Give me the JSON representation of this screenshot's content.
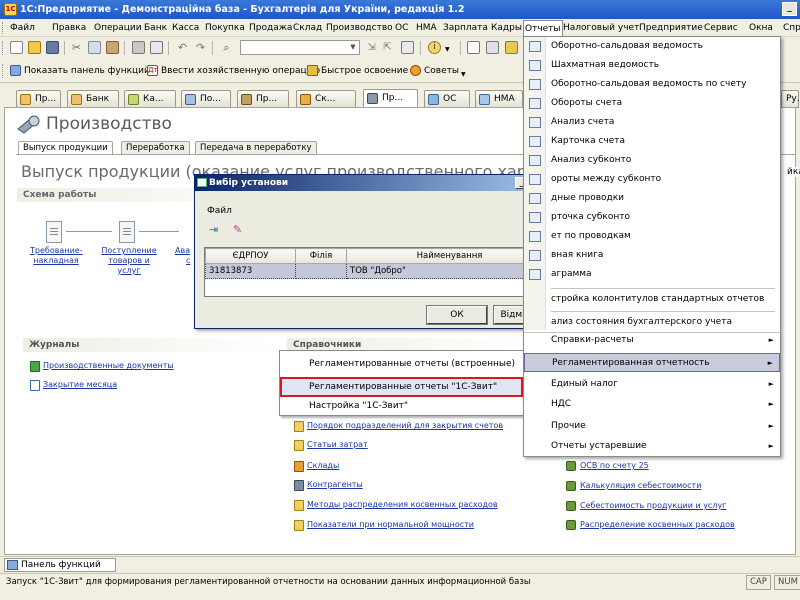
{
  "window": {
    "title": "1С:Предприятие - Демонстраційна база - Бухгалтерія для України, редакція 1.2"
  },
  "menubar": [
    "Файл",
    "Правка",
    "Операции",
    "Банк",
    "Касса",
    "Покупка",
    "Продажа",
    "Склад",
    "Производство",
    "ОС",
    "НМА",
    "Зарплата",
    "Кадры",
    "Отчеты",
    "Налоговый учет",
    "Предприятие",
    "Сервис",
    "Окна",
    "Спр"
  ],
  "toolbar2": {
    "panel": "Показать панель функций",
    "enter_op": "Ввести хозяйственную операцию",
    "quick": "Быстрое освоение",
    "tips": "Советы"
  },
  "tabs": [
    "Пр...",
    "Банк",
    "Ка...",
    "По...",
    "Пр...",
    "Ск...",
    "Пр...",
    "ОС",
    "НМА",
    "Ру..."
  ],
  "page": {
    "title": "Производство",
    "subtabs": [
      "Выпуск продукции",
      "Переработка",
      "Передача в переработку"
    ],
    "section_title": "Выпуск продукции (оказание услуг производственного характера)",
    "right_trunc": "йка."
  },
  "schema": {
    "header": "Схема работы",
    "links": [
      "Требование-накладная",
      "Поступление товаров и услуг",
      "Ава"
    ],
    "trunc": "с"
  },
  "journals": {
    "header": "Журналы",
    "items": [
      "Производственные документы",
      "Закрытие месяца"
    ]
  },
  "directories": {
    "header": "Справочники",
    "items": [
      "Порядок подразделений для закрытия счетов",
      "Статьи затрат",
      "Склады",
      "Контрагенты",
      "Методы распределения косвенных расходов",
      "Показатели при нормальной мощности"
    ]
  },
  "popup_left": [
    "Регламентированные отчеты (встроенные)",
    "Регламентированные отчеты \"1С-Звит\"",
    "Настройка \"1С-Звит\""
  ],
  "dropdown": {
    "items": [
      "Оборотно-сальдовая ведомость",
      "Шахматная ведомость",
      "Оборотно-сальдовая ведомость по счету",
      "Обороты счета",
      "Анализ счета",
      "Карточка счета",
      "Анализ субконто",
      "Обороты между субконто",
      "Сводные проводки",
      "Карточка субконто",
      "Отчет по проводкам",
      "Главная книга",
      "Диаграмма"
    ],
    "items_visible": [
      "Оборотно-сальдовая ведомость",
      "Шахматная ведомость",
      "Оборотно-сальдовая ведомость по счету",
      "Обороты счета",
      "Анализ счета",
      "Карточка счета",
      "Анализ субконто",
      "ороты между субконто",
      "дные проводки",
      "рточка субконто",
      "ет по проводкам",
      "вная книга",
      "аграмма"
    ],
    "setup": "стройка колонтитулов стандартных отчетов",
    "analysis": "ализ состояния бухгалтерского учета",
    "submenus": [
      "Справки-расчеты",
      "Регламентированная отчетность",
      "Единый налог",
      "НДС",
      "Прочие",
      "Отчеты устаревшие"
    ]
  },
  "reports_right": [
    "ОСВ по счету 25",
    "Калькуляция себестоимости",
    "Себестоимость продукции и услуг",
    "Распределение косвенных расходов"
  ],
  "dialog": {
    "title": "Вибір установи",
    "menu": "Файл",
    "columns": [
      "ЄДРПОУ",
      "Філія",
      "Найменування"
    ],
    "rows": [
      [
        "31813873",
        "",
        "ТОВ \"Добро\""
      ]
    ],
    "ok": "ОК",
    "cancel": "Відмінити"
  },
  "funcpanel": "Панель функций",
  "status": {
    "text": "Запуск \"1С-Звит\" для формирования регламентированной отчетности на основании данных информационной базы",
    "cap": "CAP",
    "num": "NUM"
  },
  "colors": {
    "title_bar": "#1f57c7",
    "link": "#1a35a8",
    "highlight_border": "#d91a1a"
  }
}
